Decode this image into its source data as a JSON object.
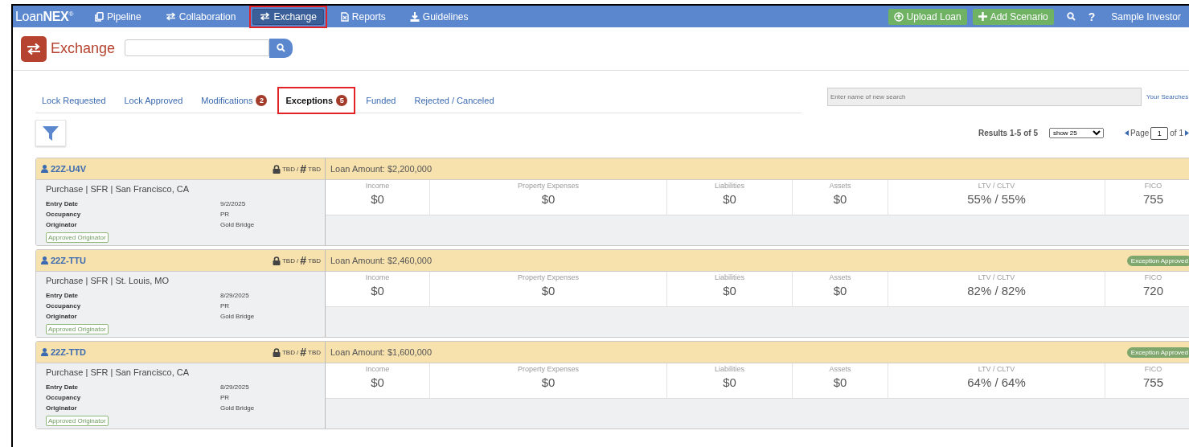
{
  "nav": {
    "logo": "Loan**NEX**$^{®}$",
    "items": [
      {
        "label": "Pipeline",
        "selected": false,
        "highlighted": false
      },
      {
        "label": "Collaboration",
        "selected": false,
        "highlighted": false
      },
      {
        "label": "Exchange",
        "selected": true,
        "highlighted": true
      },
      {
        "label": "Reports",
        "selected": false,
        "highlighted": false
      },
      {
        "label": "Guidelines",
        "selected": false,
        "highlighted": false
      }
    ],
    "actions": [
      {
        "label": "Upload Loan"
      },
      {
        "label": "Add Scenario"
      }
    ],
    "help": "?",
    "user": "Sample Investor"
  },
  "header": {
    "title": "Exchange"
  },
  "tabs": [
    {
      "label": "Lock Requested",
      "selected": false,
      "highlighted": false
    },
    {
      "label": "Lock Approved",
      "selected": false,
      "highlighted": false
    },
    {
      "label": "Modifications",
      "count": "2",
      "selected": false,
      "highlighted": false
    },
    {
      "label": "Exceptions",
      "count": "5",
      "selected": true,
      "highlighted": true
    },
    {
      "label": "Funded",
      "selected": false,
      "highlighted": false
    },
    {
      "label": "Rejected / Canceled",
      "selected": false,
      "highlighted": false
    }
  ],
  "saved_search": {
    "placeholder": "Enter name of new search",
    "link": "Your Searches"
  },
  "results": {
    "summary": "Results 1-5 of 5",
    "page_size": "show 25",
    "page_label": "Page",
    "page": "1",
    "page_total": "of 1"
  },
  "loans": [
    {
      "id": "22Z-U4V",
      "lock": "TBD",
      "separator": "/",
      "number_mark": "#",
      "number": "TBD",
      "amount": "Loan Amount: $2,200,000",
      "summary": "Purchase | SFR | San Francisco, CA",
      "details": [
        {
          "label": "Entry Date",
          "value": "9/2/2025"
        },
        {
          "label": "Occupancy",
          "value": "PR"
        },
        {
          "label": "Originator",
          "value": "Gold Bridge"
        }
      ],
      "tag": "Approved Originator",
      "metrics": [
        {
          "label": "Income",
          "value": "$0"
        },
        {
          "label": "Property Expenses",
          "value": "$0"
        },
        {
          "label": "Liabilities",
          "value": "$0"
        },
        {
          "label": "Assets",
          "value": "$0"
        },
        {
          "label": "LTV / CLTV",
          "value": "55% / 55%"
        },
        {
          "label": "FICO",
          "value": "755"
        }
      ]
    },
    {
      "id": "22Z-TTU",
      "lock": "TBD",
      "separator": "/",
      "number_mark": "#",
      "number": "TBD",
      "amount": "Loan Amount: $2,460,000",
      "status": "Exception Approved",
      "summary": "Purchase | SFR | St. Louis, MO",
      "details": [
        {
          "label": "Entry Date",
          "value": "8/29/2025"
        },
        {
          "label": "Occupancy",
          "value": "PR"
        },
        {
          "label": "Originator",
          "value": "Gold Bridge"
        }
      ],
      "tag": "Approved Originator",
      "metrics": [
        {
          "label": "Income",
          "value": "$0"
        },
        {
          "label": "Property Expenses",
          "value": "$0"
        },
        {
          "label": "Liabilities",
          "value": "$0"
        },
        {
          "label": "Assets",
          "value": "$0"
        },
        {
          "label": "LTV / CLTV",
          "value": "82% / 82%"
        },
        {
          "label": "FICO",
          "value": "720"
        }
      ]
    },
    {
      "id": "22Z-TTD",
      "lock": "TBD",
      "separator": "/",
      "number_mark": "#",
      "number": "TBD",
      "amount": "Loan Amount: $1,600,000",
      "status": "Exception Approved",
      "summary": "Purchase | SFR | San Francisco, CA",
      "details": [
        {
          "label": "Entry Date",
          "value": "8/29/2025"
        },
        {
          "label": "Occupancy",
          "value": "PR"
        },
        {
          "label": "Originator",
          "value": "Gold Bridge"
        }
      ],
      "tag": "Approved Originator",
      "metrics": [
        {
          "label": "Income",
          "value": "$0"
        },
        {
          "label": "Property Expenses",
          "value": "$0"
        },
        {
          "label": "Liabilities",
          "value": "$0"
        },
        {
          "label": "Assets",
          "value": "$0"
        },
        {
          "label": "LTV / CLTV",
          "value": "64% / 64%"
        },
        {
          "label": "FICO",
          "value": "755"
        }
      ]
    }
  ]
}
